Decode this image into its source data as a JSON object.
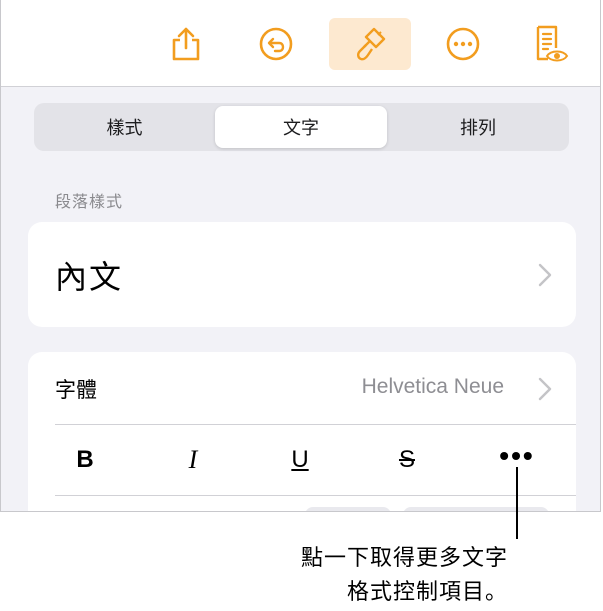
{
  "toolbar": {
    "buttons": [
      {
        "icon": "share-icon"
      },
      {
        "icon": "undo-icon"
      },
      {
        "icon": "paintbrush-icon",
        "active": true
      },
      {
        "icon": "more-icon"
      },
      {
        "icon": "reading-view-icon"
      }
    ],
    "accent_color": "#f29d1f",
    "active_bg": "#fde9d0"
  },
  "tabs": [
    {
      "label": "樣式"
    },
    {
      "label": "文字",
      "selected": true
    },
    {
      "label": "排列"
    }
  ],
  "paragraph_style": {
    "section_label": "段落樣式",
    "value": "內文"
  },
  "font": {
    "label": "字體",
    "value": "Helvetica Neue"
  },
  "format_buttons": {
    "bold": "B",
    "italic": "I",
    "underline": "U",
    "strikethrough": "S",
    "more": "•••"
  },
  "callout": {
    "line1": "點一下取得更多文字",
    "line2": "格式控制項目。"
  }
}
